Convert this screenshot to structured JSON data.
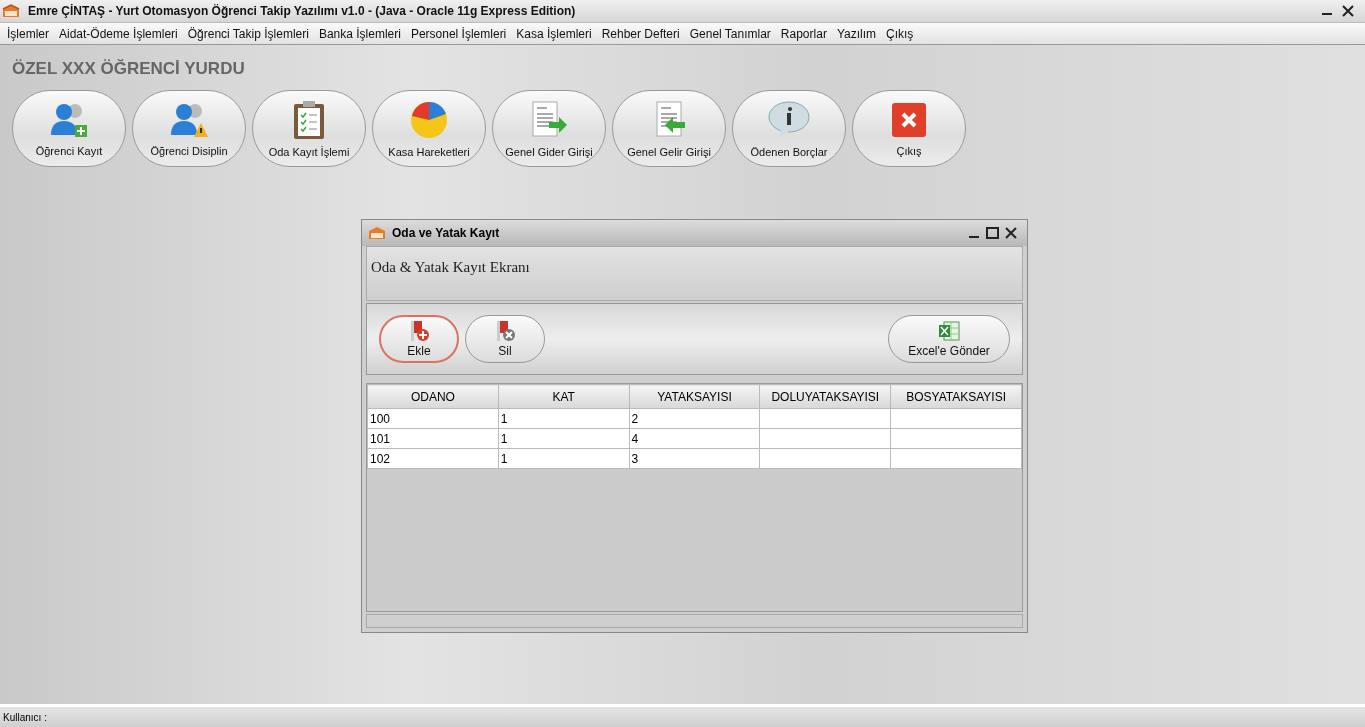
{
  "window": {
    "title": "Emre ÇİNTAŞ - Yurt Otomasyon Öğrenci Takip Yazılımı v1.0 - (Java - Oracle 11g Express Edition)"
  },
  "menu": [
    "İşlemler",
    "Aidat-Ödeme İşlemleri",
    "Öğrenci Takip İşlemleri",
    "Banka İşlemleri",
    "Personel İşlemleri",
    "Kasa İşlemleri",
    "Rehber Defteri",
    "Genel Tanımlar",
    "Raporlar",
    "Yazılım",
    "Çıkış"
  ],
  "heading": "ÖZEL XXX ÖĞRENCİ YURDU",
  "toolbar": [
    "Öğrenci Kayıt",
    "Öğrenci Disiplin",
    "Oda Kayıt İşlemi",
    "Kasa Hareketleri",
    "Genel Gider Girişi",
    "Genel Gelir Girişi",
    "Ödenen Borçlar",
    "Çıkış"
  ],
  "dialog": {
    "title": "Oda ve Yatak Kayıt",
    "subtitle": "Oda & Yatak Kayıt Ekranı",
    "buttons": [
      {
        "label": "Ekle",
        "focused": true
      },
      {
        "label": "Sil",
        "focused": false
      }
    ],
    "export_button": "Excel'e Gönder",
    "table": {
      "columns": [
        "ODANO",
        "KAT",
        "YATAKSAYISI",
        "DOLUYATAKSAYISI",
        "BOSYATAKSAYISI"
      ],
      "rows": [
        [
          "100",
          "1",
          "2",
          "",
          ""
        ],
        [
          "101",
          "1",
          "4",
          "",
          ""
        ],
        [
          "102",
          "1",
          "3",
          "",
          ""
        ]
      ]
    }
  },
  "status_bar": {
    "label": "Kullanıcı :"
  }
}
